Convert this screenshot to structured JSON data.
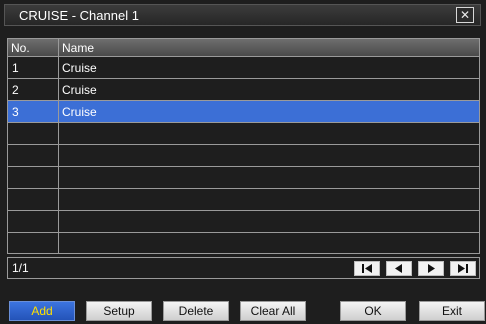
{
  "window": {
    "title": "CRUISE - Channel 1",
    "close_glyph": "✕"
  },
  "table": {
    "columns": [
      "No.",
      "Name"
    ],
    "rows": [
      {
        "no": "1",
        "name": "Cruise"
      },
      {
        "no": "2",
        "name": "Cruise"
      },
      {
        "no": "3",
        "name": "Cruise"
      }
    ],
    "selected_row_index": 2
  },
  "pager": {
    "page_text": "1/1",
    "buttons": [
      "first-page-icon",
      "prev-page-icon",
      "next-page-icon",
      "last-page-icon"
    ]
  },
  "actions": {
    "add": "Add",
    "setup": "Setup",
    "delete": "Delete",
    "clear_all": "Clear All",
    "ok": "OK",
    "exit": "Exit"
  },
  "colors": {
    "selection": "#3c6fd6",
    "active_button": "#2f63cc",
    "active_text": "#ffe000"
  }
}
